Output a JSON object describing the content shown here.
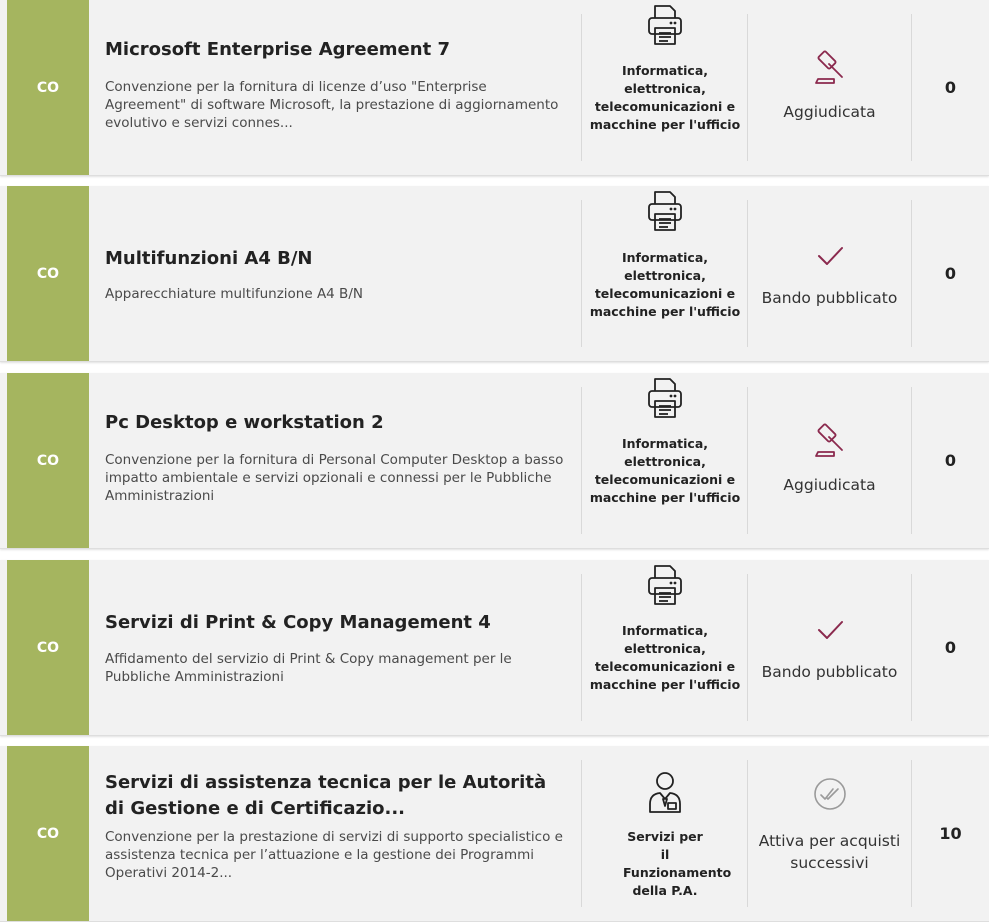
{
  "rows": [
    {
      "type": "CO",
      "title": "Microsoft Enterprise Agreement 7",
      "description": "Convenzione per la fornitura di licenze d’uso \"Enterprise Agreement\" di software Microsoft, la prestazione di aggiornamento evolutivo e servizi connes...",
      "category_icon": "printer-icon",
      "category": "Informatica, elettronica, telecomunicazioni e macchine per l'ufficio",
      "status_icon": "gavel-icon",
      "status": "Aggiudicata",
      "count": "0"
    },
    {
      "type": "CO",
      "title": "Multifunzioni A4 B/N",
      "description": "Apparecchiature multifunzione A4 B/N",
      "category_icon": "printer-icon",
      "category": "Informatica, elettronica, telecomunicazioni e macchine per l'ufficio",
      "status_icon": "checkmark-icon",
      "status": "Bando pubblicato",
      "count": "0"
    },
    {
      "type": "CO",
      "title": "Pc Desktop e workstation 2",
      "description": "Convenzione per la fornitura di Personal Computer Desktop a basso impatto ambientale e servizi opzionali e connessi per le Pubbliche Amministrazioni",
      "category_icon": "printer-icon",
      "category": "Informatica, elettronica, telecomunicazioni e macchine per l'ufficio",
      "status_icon": "gavel-icon",
      "status": "Aggiudicata",
      "count": "0"
    },
    {
      "type": "CO",
      "title": "Servizi di Print & Copy Management 4",
      "description": "Affidamento del servizio di Print & Copy management per le Pubbliche Amministrazioni",
      "category_icon": "printer-icon",
      "category": "Informatica, elettronica, telecomunicazioni e macchine per l'ufficio",
      "status_icon": "checkmark-icon",
      "status": "Bando pubblicato",
      "count": "0"
    },
    {
      "type": "CO",
      "title": "Servizi di assistenza tecnica per le Autorità di Gestione e di Certificazio...",
      "description": "Convenzione per la prestazione di servizi di supporto specialistico e assistenza tecnica per l’attuazione e la gestione dei Programmi Operativi 2014-2...",
      "category_icon": "businessman-icon",
      "category": "Servizi per il Funzionamento della P.A.",
      "status_icon": "double-check-circle-icon",
      "status": "Attiva per acquisti successivi",
      "count": "10"
    }
  ],
  "colors": {
    "type_badge": "#a5b55f",
    "status_icon_active": "#8b2a4e",
    "status_icon_muted": "#9a9a9a",
    "row_background": "#f2f2f2"
  }
}
